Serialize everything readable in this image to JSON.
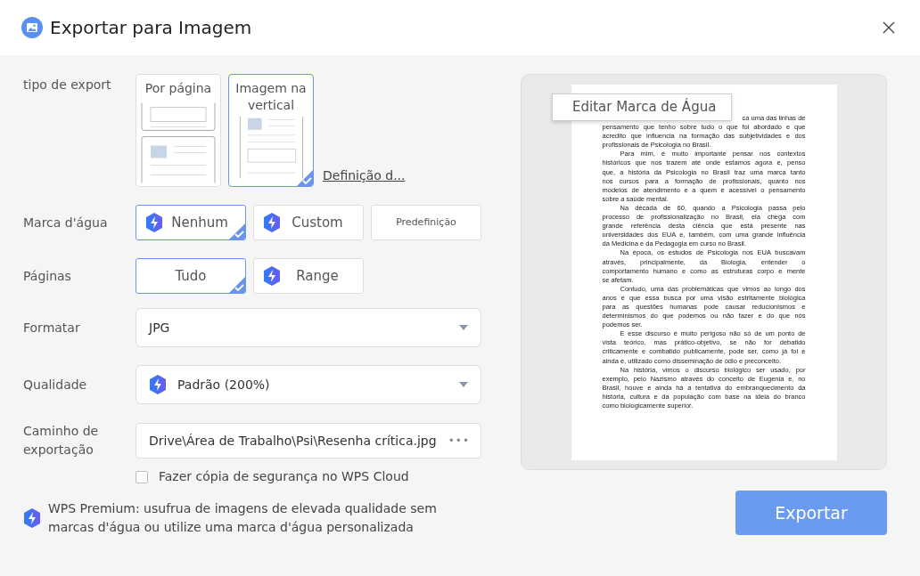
{
  "window": {
    "title": "Exportar para Imagem"
  },
  "export_type": {
    "label": "tipo de export",
    "settings_link": "Definição d...",
    "options": [
      {
        "label": "Por página",
        "kind": "paged",
        "selected": false
      },
      {
        "label": "Imagem na vertical",
        "kind": "long",
        "selected": true
      }
    ]
  },
  "watermark": {
    "label": "Marca d'água",
    "options": [
      {
        "label": "Nenhum",
        "kind": "normal",
        "premium": true,
        "selected": true
      },
      {
        "label": "Custom",
        "kind": "normal",
        "premium": true,
        "selected": false
      },
      {
        "label": "Predefinição",
        "kind": "compact",
        "premium": false,
        "selected": false
      }
    ]
  },
  "pages": {
    "label": "Páginas",
    "options": [
      {
        "label": "Tudo",
        "premium": false,
        "selected": true
      },
      {
        "label": "Range",
        "premium": true,
        "selected": false
      }
    ]
  },
  "format": {
    "label": "Formatar",
    "value": "JPG",
    "premium": false
  },
  "quality": {
    "label": "Qualidade",
    "value": "Padrão (200%)",
    "premium": true
  },
  "path": {
    "label": "Caminho de exportação",
    "value": "Drive\\Área de Trabalho\\Psi\\Resenha crítica.jpg",
    "browse": "•••"
  },
  "backup": {
    "label": "Fazer cópia de segurança no WPS Cloud",
    "checked": false
  },
  "premium_note": "WPS Premium: usufrua de imagens de elevada qualidade sem marcas d'água ou utilize uma marca d'água personalizada",
  "preview": {
    "tooltip": "Editar Marca de Água",
    "paragraphs": [
      {
        "continued": true,
        "lines": [
          "ca uma das linhas de",
          "pensamento que tenho sobre tudo o que foi abordado e que",
          "acredito que influencia na formação das subjetividades e dos",
          "profissionais de Psicologia no Brasil."
        ]
      },
      {
        "continued": false,
        "lines": [
          "Para mim, é muito importante pensar nos contextos",
          "históricos que nos trazem até onde estamos agora e, penso",
          "que, a história da Psicologia no Brasil traz uma marca tanto",
          "nos cursos para a formação de profissionais, quanto nos",
          "modelos de atendimento e a quem é acessível o pensamento",
          "sobre a saúde mental."
        ]
      },
      {
        "continued": false,
        "lines": [
          "Na década de 60, quando a Psicologia passa pelo",
          "processo de profissionalização no Brasil, ela chega com",
          "grande referência desta ciência que está presente nas",
          "universidades dos EUA e, também, com uma grande influência",
          "da Medicina e da Pedagogia em curso no Brasil."
        ]
      },
      {
        "continued": false,
        "lines": [
          "Na época, os estudos de Psicologia nos EUA buscavam",
          "através, principalmente, da Biologia, entender o",
          "comportamento humano e como as estruturas corpo e mente",
          "se afetam."
        ]
      },
      {
        "continued": false,
        "lines": [
          "Contudo, uma das problemáticas que vimos ao longo dos",
          "anos é que essa busca por uma visão estritamente biológica",
          "para as questões humanas pode causar reducionismos e",
          "determinismos do que podemos ou não fazer e do que nós",
          "podemos ser."
        ]
      },
      {
        "continued": false,
        "lines": [
          "E esse discurso é muito perigoso não só de um ponto de",
          "vista teórico, mas prático-objetivo, se não for debatido",
          "criticamente e combatido publicamente, pode ser, como já foi e",
          "ainda é, utilizado como disseminação de ódio e preconceito."
        ]
      },
      {
        "continued": false,
        "lines": [
          "Na história, vimos o discurso biológico ser usado, por",
          "exemplo, pelo Nazismo através do conceito de Eugenia e, no",
          "Brasil, houve e ainda há a tentativa do embranquecimento da",
          "história, cultura e da população com base na ideia do branco",
          "como biologicamente superior."
        ]
      }
    ]
  },
  "export_button": "Exportar"
}
